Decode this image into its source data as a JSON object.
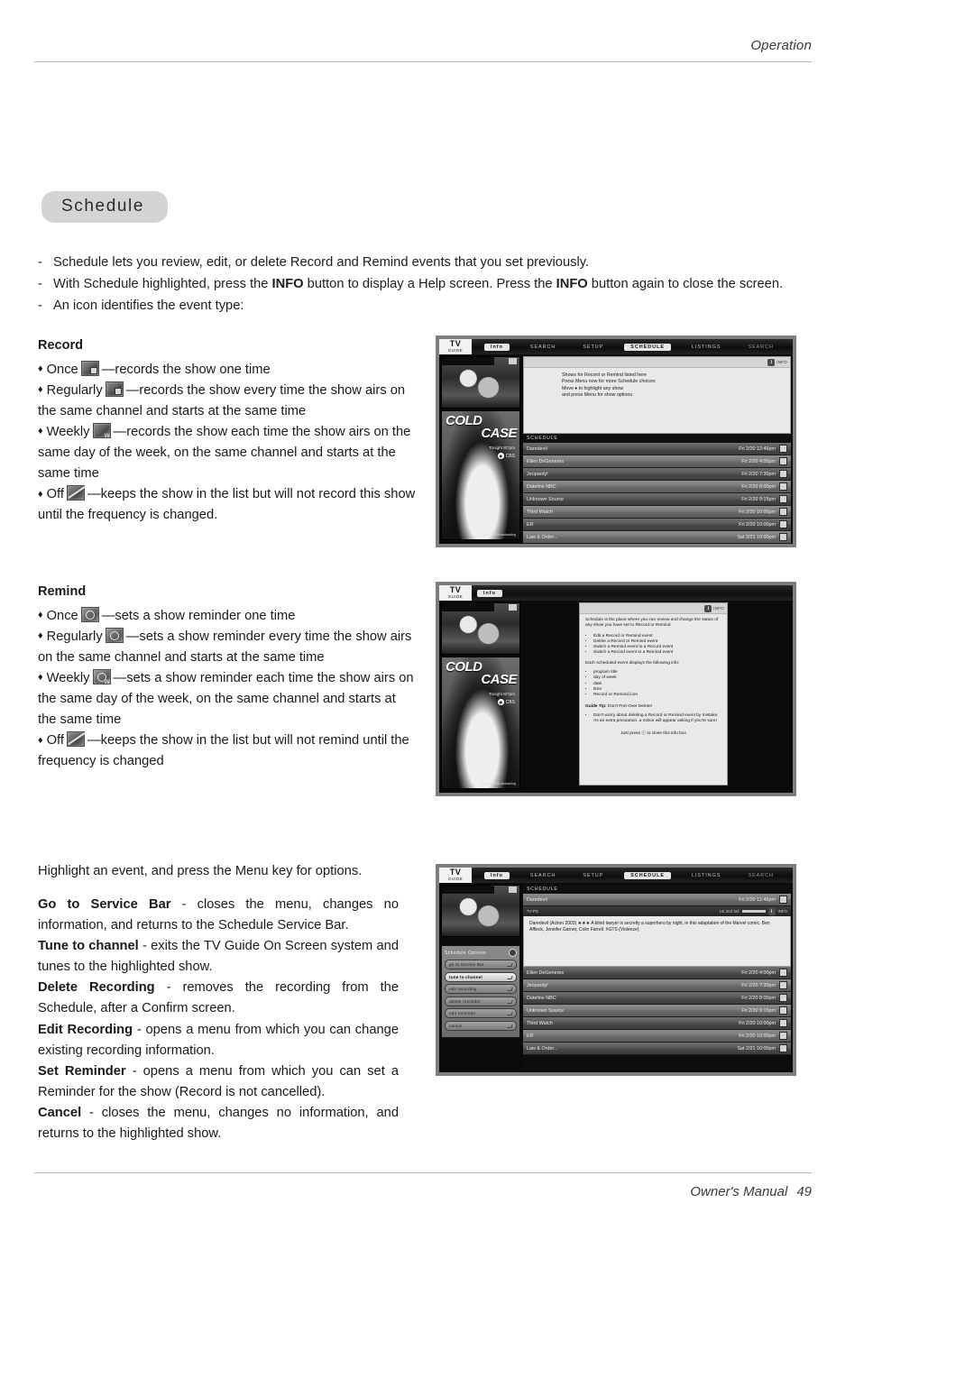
{
  "header": {
    "section": "Operation"
  },
  "footer": {
    "manual": "Owner's Manual",
    "page": "49"
  },
  "chip": {
    "label": "Schedule"
  },
  "intro": {
    "mark": "-",
    "items": [
      "Schedule lets you review, edit, or delete Record and Remind events that you set previously.",
      "With Schedule highlighted, press the INFO button to display a Help screen. Press the INFO button again to close the screen.",
      "An icon identifies the event type:"
    ]
  },
  "record": {
    "heading": "Record",
    "bullet": "♦",
    "items": [
      {
        "label": "Once",
        "icon": "record-once-icon",
        "text": "—records the show one time"
      },
      {
        "label": "Regularly",
        "icon": "record-regularly-icon",
        "text": "—records the show every time the show airs on the same channel and starts at the same time"
      },
      {
        "label": "Weekly",
        "icon": "record-weekly-icon",
        "text": "—records the show each time the show airs on the same day of the week, on the same channel and starts at the same time"
      },
      {
        "label": "Off",
        "icon": "record-off-icon",
        "text": "—keeps the show in the list but will not record this show until the frequency is changed."
      }
    ]
  },
  "remind": {
    "heading": "Remind",
    "bullet": "♦",
    "items": [
      {
        "label": "Once",
        "icon": "remind-once-icon",
        "text": "—sets a show reminder one time"
      },
      {
        "label": "Regularly",
        "icon": "remind-regularly-icon",
        "text": "—sets a show reminder every time the show airs on the same channel and starts at the same time"
      },
      {
        "label": "Weekly",
        "icon": "remind-weekly-icon",
        "text": "—sets a show reminder each time the show airs on the same day of the week, on the same channel and starts at the same time"
      },
      {
        "label": "Off",
        "icon": "remind-off-icon",
        "text": "—keeps the show in the list but will not remind until the frequency is changed"
      }
    ]
  },
  "options": {
    "intro": "Highlight an event, and press the Menu key for options.",
    "items": [
      {
        "term": "Go to Service Bar",
        "desc": " - closes the menu, changes no information, and returns to the Schedule Service Bar."
      },
      {
        "term": "Tune to channel",
        "desc": " - exits the  TV Guide On Screen system and tunes to the highlighted show."
      },
      {
        "term": "Delete Recording",
        "desc": " - removes the recording from the Schedule, after a Confirm screen."
      },
      {
        "term": "Edit Recording",
        "desc": " - opens a menu from which you can change existing recording information."
      },
      {
        "term": "Set Reminder",
        "desc": " - opens a menu from which you can set a Reminder for the show (Record is not cancelled)."
      },
      {
        "term": "Cancel",
        "desc": " - closes the menu, changes no information, and returns to the highlighted show."
      }
    ]
  },
  "tv": {
    "logo": {
      "main": "TV",
      "sub": "GUIDE"
    },
    "menubar": [
      "Info",
      "SEARCH",
      "SETUP",
      "SCHEDULE",
      "LISTINGS",
      "SEARCH"
    ],
    "menubar_selected": "SCHEDULE",
    "poster": {
      "line1": "COLD",
      "line2": "CASE",
      "sub": "Tonight 8/7pm",
      "network": "CBS",
      "credit": "2004 CBS Broadcasting"
    },
    "schedule_label": "SCHEDULE",
    "info_key": "INFO",
    "shot1": {
      "help_lines": [
        "Shows for Record or Remind listed here",
        "Press Menu now for more Schedule choices",
        "Move ♦ to highlight any show",
        "and press Menu for show options"
      ],
      "rows": [
        {
          "title": "Daredevil",
          "when": "Fri 2/20  12:46pm"
        },
        {
          "title": "Ellen DeGeneres",
          "when": "Fri 2/20   4:00pm"
        },
        {
          "title": "Jeopardy!",
          "when": "Fri 2/20   7:30pm"
        },
        {
          "title": "Dateline NBC",
          "when": "Fri 2/20   8:00pm"
        },
        {
          "title": "Unknown Source",
          "when": "Fri 2/20   9:15pm"
        },
        {
          "title": "Third Watch",
          "when": "Fri 2/20  10:00pm"
        },
        {
          "title": "ER",
          "when": "Fri 2/20  10:00pm"
        },
        {
          "title": "Law & Order...",
          "when": "Sat 2/21  10:00pm"
        }
      ]
    },
    "shot2": {
      "help_title": "Schedule is the place where you can review and change the status of any show you have set to Record or Remind.",
      "help_bullets_1": [
        "Edit a Record or Remind event",
        "Delete a Record or Remind event",
        "Switch a Remind event to a Record event",
        "Switch a Record event to a Remind event"
      ],
      "help_mid": "Each scheduled event displays the following info:",
      "help_bullets_2": [
        "program title",
        "day of week",
        "date",
        "time",
        "Record or Remind icon"
      ],
      "tip_label": "Guide Tip:",
      "tip_text": " Don't Fret Over Delete!",
      "tip_bullets": [
        "Don't worry about deleting a Record or Remind event by mistake. As an extra precaution, a notice will appear asking if you're sure!"
      ],
      "help_footer": "Just press ⓘ to close this info box"
    },
    "shot3": {
      "menu_title": "Schedule Options",
      "menu_items": [
        "go to Service Bar",
        "tune to channel",
        "edit recording",
        "delete reminder",
        "edit reminder",
        "cancel"
      ],
      "menu_selected": "tune to channel",
      "selected_row": {
        "title": "Daredevil",
        "when": "Fri 2/20  12:46pm"
      },
      "detail_left": "TV-PG",
      "detail_rating": "1st  2nd  3rd",
      "detail_info": "INFO",
      "description": "Daredevil (Action 2003) ★★★ A blind lawyer is secretly a superhero by night, in this adaptation of the Marvel comic. Ben Affleck, Jennifer Garner, Colin Farrell. #GTS (Violence)",
      "rows": [
        {
          "title": "Ellen DeGeneres",
          "when": "Fri 2/20   4:00pm"
        },
        {
          "title": "Jeopardy!",
          "when": "Fri 2/20   7:30pm"
        },
        {
          "title": "Dateline NBC",
          "when": "Fri 2/20   8:00pm"
        },
        {
          "title": "Unknown Source",
          "when": "Fri 2/20   9:15pm"
        },
        {
          "title": "Third Watch",
          "when": "Fri 2/20  10:00pm"
        },
        {
          "title": "ER",
          "when": "Fri 2/20  10:00pm"
        },
        {
          "title": "Law & Order...",
          "when": "Sat 2/21  10:00pm"
        }
      ]
    }
  }
}
